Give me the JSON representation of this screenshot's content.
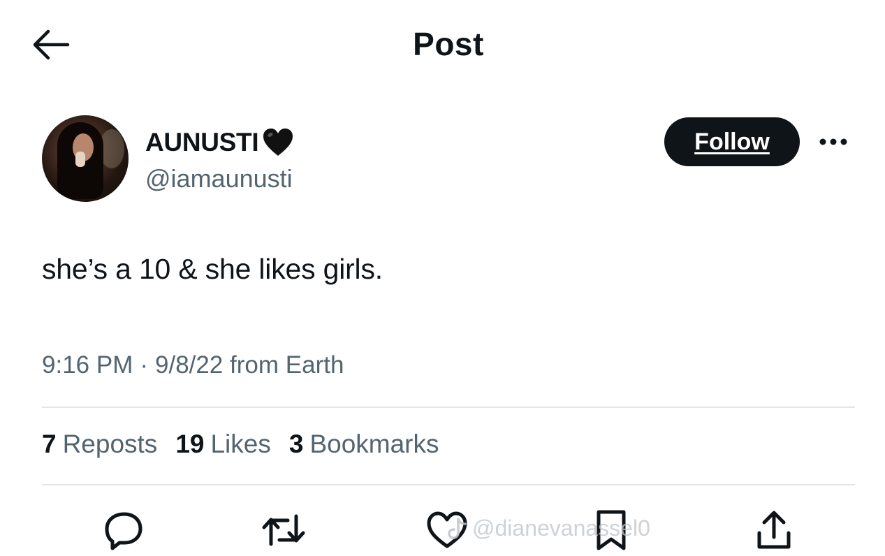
{
  "header": {
    "title": "Post",
    "back_icon": "arrow-left-icon"
  },
  "author": {
    "display_name": "AUNUSTI",
    "name_emoji_icon": "black-heart-icon",
    "handle": "@iamaunusti",
    "follow_label": "Follow",
    "more_icon": "more-dots-icon"
  },
  "post": {
    "text": "she’s a 10 & she likes girls.",
    "time": "9:16 PM",
    "separator": "·",
    "date_source": "9/8/22 from Earth"
  },
  "stats": [
    {
      "count": "7",
      "label": "Reposts"
    },
    {
      "count": "19",
      "label": "Likes"
    },
    {
      "count": "3",
      "label": "Bookmarks"
    }
  ],
  "actions": [
    {
      "name": "reply",
      "icon": "reply-bubble-icon"
    },
    {
      "name": "repost",
      "icon": "repost-arrows-icon"
    },
    {
      "name": "like",
      "icon": "heart-outline-icon"
    },
    {
      "name": "bookmark",
      "icon": "bookmark-icon"
    },
    {
      "name": "share",
      "icon": "share-upload-icon"
    }
  ],
  "watermark": {
    "text": "@dianevanassel0",
    "icon": "tiktok-logo-icon"
  },
  "colors": {
    "text_primary": "#0f1419",
    "text_secondary": "#536471",
    "divider": "#e3e6e8",
    "follow_bg": "#0f1419",
    "follow_text": "#ffffff"
  }
}
